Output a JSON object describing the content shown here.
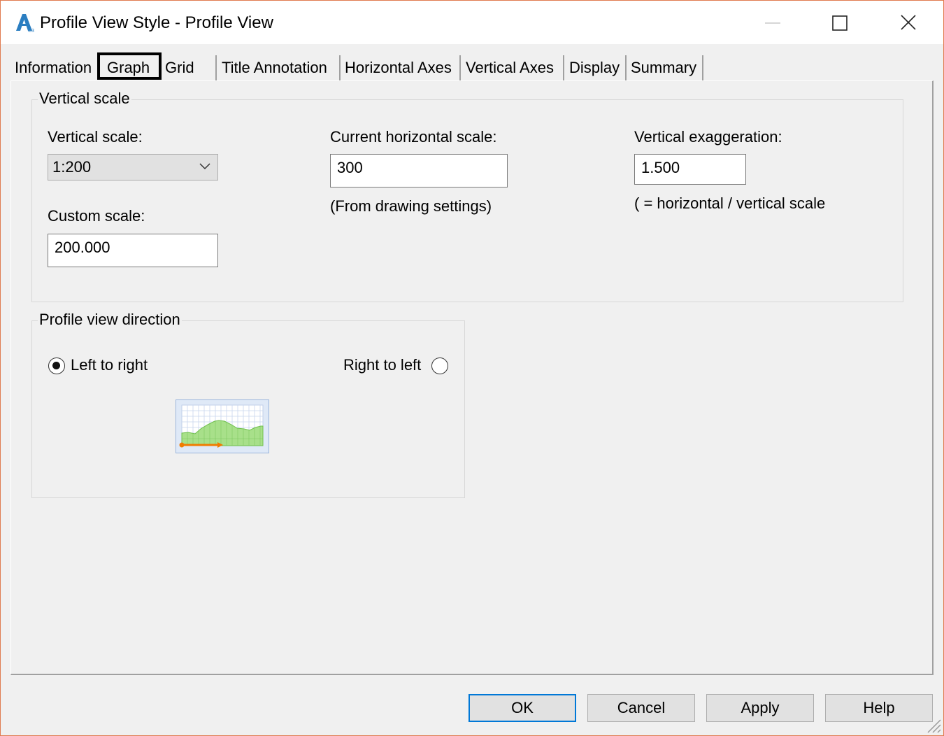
{
  "window": {
    "title": "Profile View Style - Profile View",
    "icon": "autocad-civil3d-app-icon",
    "controls": [
      "minimize-icon",
      "maximize-icon",
      "close-icon"
    ]
  },
  "tabs": [
    {
      "label": "Information"
    },
    {
      "label": "Graph",
      "selected": true
    },
    {
      "label": "Grid"
    },
    {
      "label": "Title Annotation"
    },
    {
      "label": "Horizontal Axes"
    },
    {
      "label": "Vertical Axes"
    },
    {
      "label": "Display"
    },
    {
      "label": "Summary"
    }
  ],
  "vertical_scale_group": {
    "legend": "Vertical scale",
    "vertical_scale_label": "Vertical scale:",
    "vertical_scale_value": "1:200",
    "custom_scale_label": "Custom scale:",
    "custom_scale_value": "200.000",
    "current_horizontal_scale_label": "Current horizontal scale:",
    "current_horizontal_scale_value": "300",
    "from_drawing_settings_note": "(From drawing settings)",
    "vertical_exaggeration_label": "Vertical exaggeration:",
    "vertical_exaggeration_value": "1.500",
    "exaggeration_note": "( = horizontal / vertical scale"
  },
  "direction_group": {
    "legend": "Profile view direction",
    "left_to_right_label": "Left to right",
    "left_to_right_checked": true,
    "right_to_left_label": "Right to left",
    "right_to_left_checked": false,
    "preview_icon": "profile-direction-preview-icon"
  },
  "buttons": {
    "ok": "OK",
    "cancel": "Cancel",
    "apply": "Apply",
    "help": "Help"
  },
  "colors": {
    "accent": "#0078d7",
    "window_border": "#e07b4f",
    "preview_fill": "#a8e08a",
    "preview_arrow": "#f07c00"
  }
}
